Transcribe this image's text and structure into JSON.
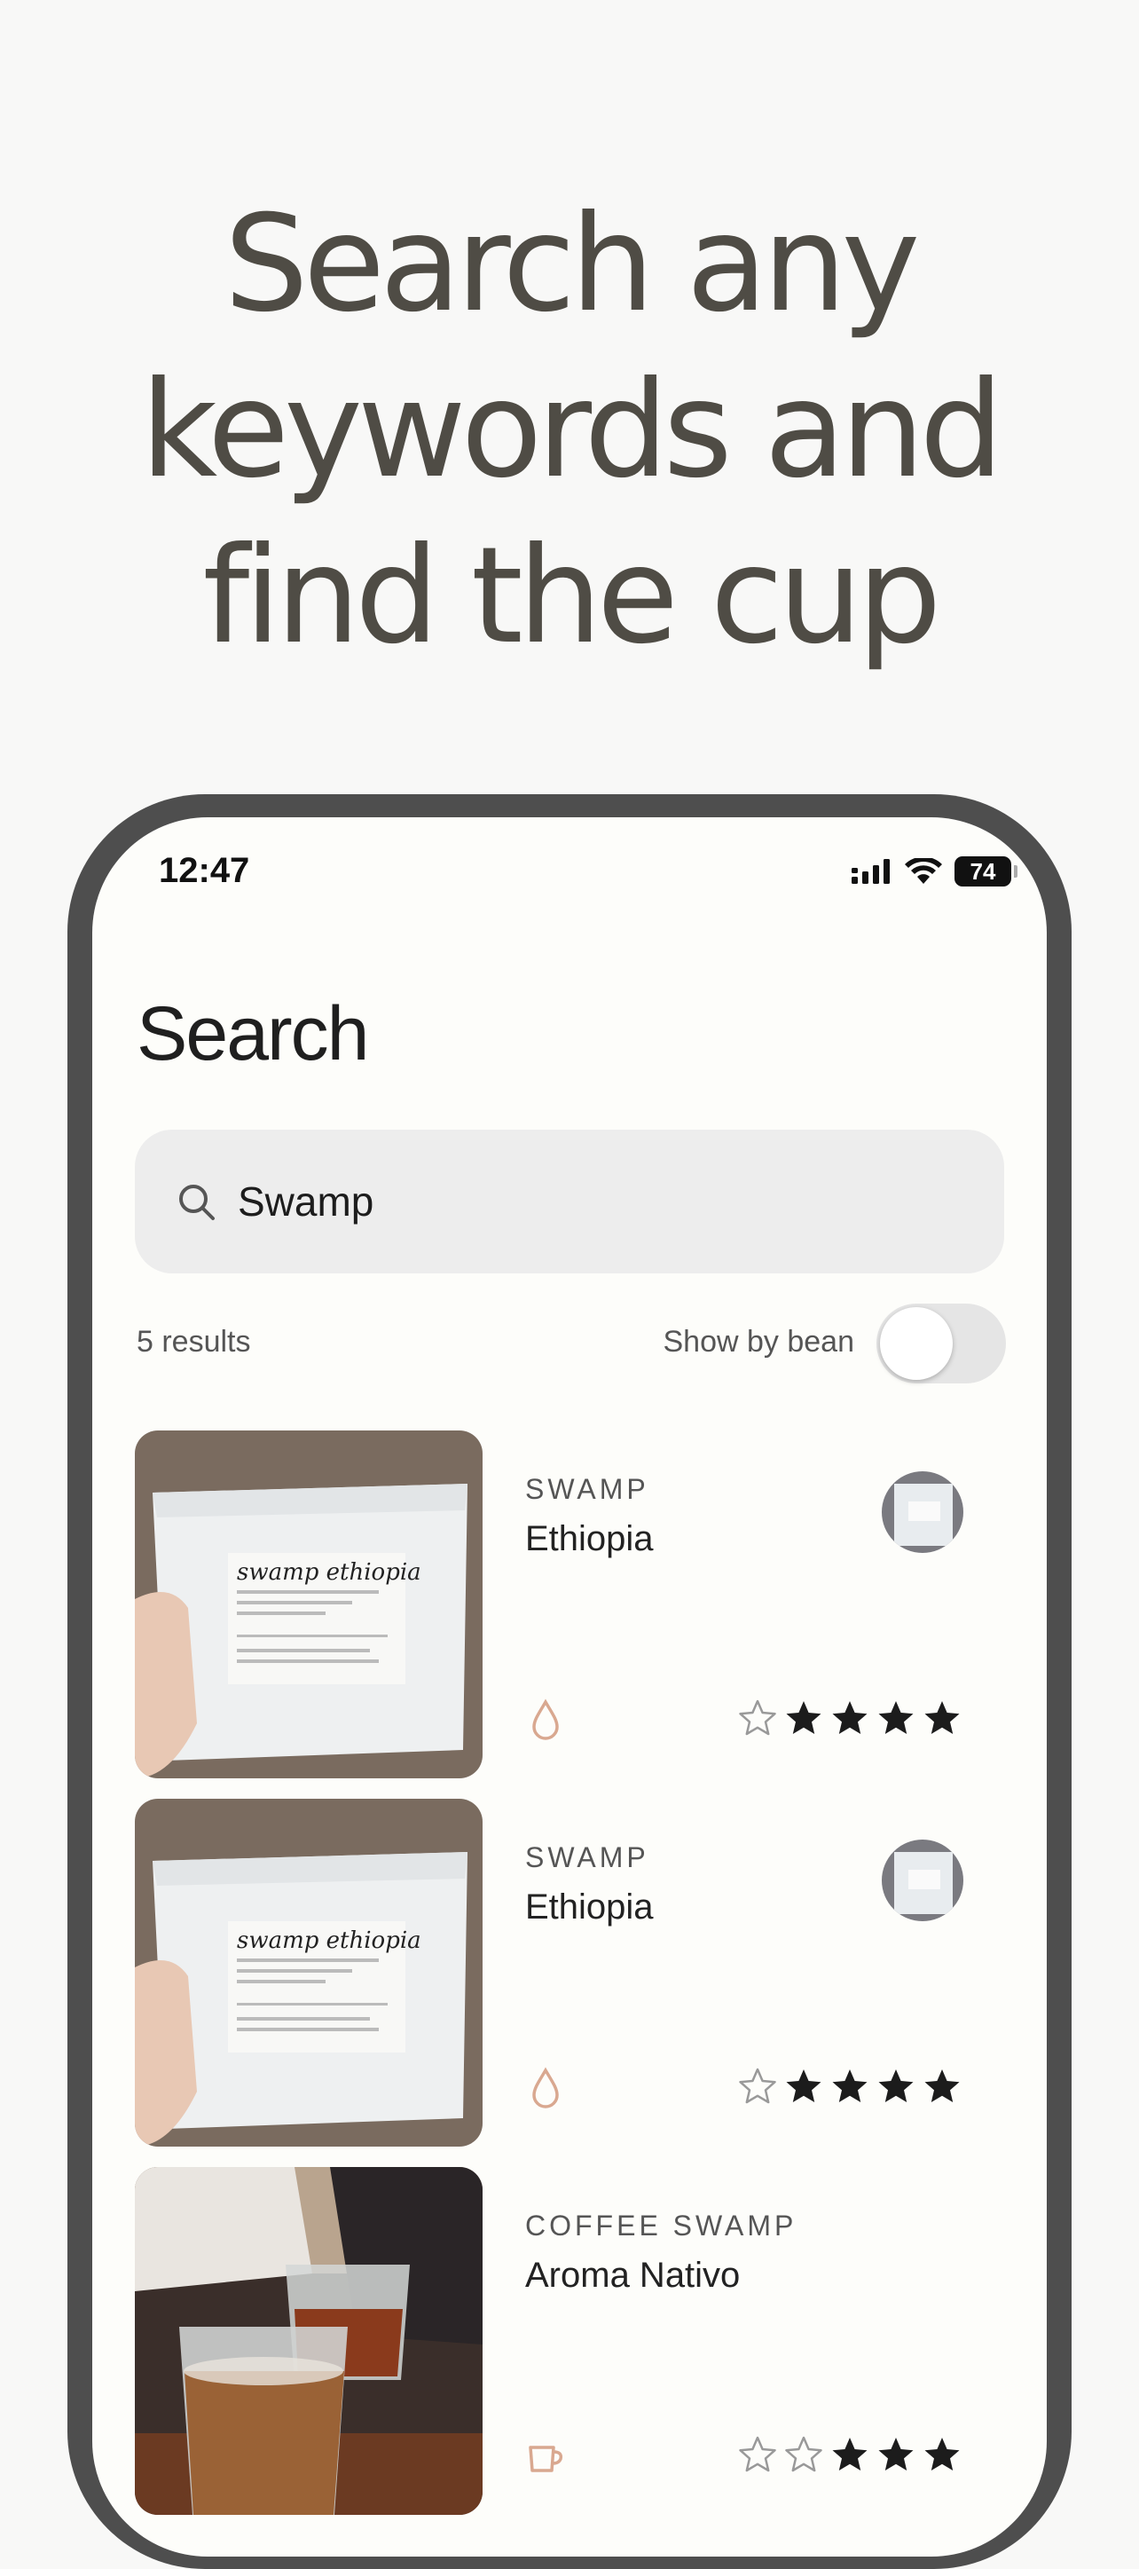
{
  "headline": {
    "line1": "Search any",
    "line2": "keywords and",
    "line3": "find the cup"
  },
  "status_bar": {
    "time": "12:47",
    "battery": "74"
  },
  "page_title": "Search",
  "search": {
    "value": "Swamp",
    "placeholder": ""
  },
  "results": {
    "count_label": "5 results",
    "toggle_label": "Show by bean",
    "toggle_on": false
  },
  "items": [
    {
      "roaster": "SWAMP",
      "name": "Ethiopia",
      "rating": 4,
      "brew_method": "drip-icon",
      "bag_label": "swamp ethiopia"
    },
    {
      "roaster": "SWAMP",
      "name": "Ethiopia",
      "rating": 4,
      "brew_method": "drip-icon",
      "bag_label": "swamp ethiopia"
    },
    {
      "roaster": "COFFEE SWAMP",
      "name": "Aroma Nativo",
      "rating": 3,
      "brew_method": "cup-icon"
    }
  ],
  "colors": {
    "accent": "#d9a890",
    "headline": "#4f4c45",
    "frame": "#4e4e4e"
  }
}
